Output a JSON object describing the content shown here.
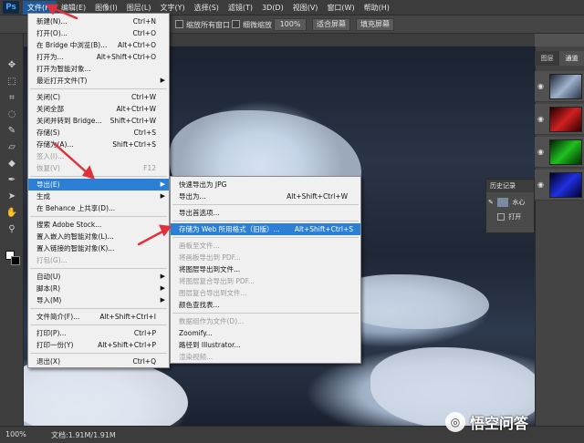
{
  "app": {
    "logo": "Ps"
  },
  "menubar": [
    "文件(F)",
    "编辑(E)",
    "图像(I)",
    "图层(L)",
    "文字(Y)",
    "选择(S)",
    "滤镜(T)",
    "3D(D)",
    "视图(V)",
    "窗口(W)",
    "帮助(H)"
  ],
  "options": {
    "fit_all_windows": "缩放所有窗口",
    "scrubby_zoom": "细微缩放",
    "zoom_value": "100%",
    "fit_screen": "适合屏幕",
    "fill_screen": "填充屏幕"
  },
  "file_menu": [
    {
      "label": "新建(N)...",
      "shortcut": "Ctrl+N"
    },
    {
      "label": "打开(O)...",
      "shortcut": "Ctrl+O"
    },
    {
      "label": "在 Bridge 中浏览(B)...",
      "shortcut": "Alt+Ctrl+O"
    },
    {
      "label": "打开为...",
      "shortcut": "Alt+Shift+Ctrl+O"
    },
    {
      "label": "打开为智能对象...",
      "shortcut": ""
    },
    {
      "label": "最近打开文件(T)",
      "shortcut": "",
      "submenu": true
    },
    {
      "label": "关闭(C)",
      "shortcut": "Ctrl+W"
    },
    {
      "label": "关闭全部",
      "shortcut": "Alt+Ctrl+W"
    },
    {
      "label": "关闭并转到 Bridge...",
      "shortcut": "Shift+Ctrl+W"
    },
    {
      "label": "存储(S)",
      "shortcut": "Ctrl+S"
    },
    {
      "label": "存储为(A)...",
      "shortcut": "Shift+Ctrl+S"
    },
    {
      "label": "签入(I)...",
      "shortcut": "",
      "disabled": true
    },
    {
      "label": "恢复(V)",
      "shortcut": "F12",
      "disabled": true
    },
    {
      "label": "导出(E)",
      "shortcut": "",
      "submenu": true,
      "highlight": true
    },
    {
      "label": "生成",
      "shortcut": "",
      "submenu": true
    },
    {
      "label": "在 Behance 上共享(D)...",
      "shortcut": ""
    },
    {
      "label": "搜索 Adobe Stock...",
      "shortcut": ""
    },
    {
      "label": "置入嵌入的智能对象(L)...",
      "shortcut": ""
    },
    {
      "label": "置入链接的智能对象(K)...",
      "shortcut": ""
    },
    {
      "label": "打包(G)...",
      "shortcut": "",
      "disabled": true
    },
    {
      "label": "自动(U)",
      "shortcut": "",
      "submenu": true
    },
    {
      "label": "脚本(R)",
      "shortcut": "",
      "submenu": true
    },
    {
      "label": "导入(M)",
      "shortcut": "",
      "submenu": true
    },
    {
      "label": "文件简介(F)...",
      "shortcut": "Alt+Shift+Ctrl+I"
    },
    {
      "label": "打印(P)...",
      "shortcut": "Ctrl+P"
    },
    {
      "label": "打印一份(Y)",
      "shortcut": "Alt+Shift+Ctrl+P"
    },
    {
      "label": "退出(X)",
      "shortcut": "Ctrl+Q"
    }
  ],
  "export_menu": [
    {
      "label": "快速导出为 JPG",
      "shortcut": ""
    },
    {
      "label": "导出为...",
      "shortcut": "Alt+Shift+Ctrl+W"
    },
    {
      "label": "导出首选项...",
      "shortcut": ""
    },
    {
      "label": "存储为 Web 所用格式（旧版）...",
      "shortcut": "Alt+Shift+Ctrl+S",
      "highlight": true
    },
    {
      "label": "画板至文件...",
      "shortcut": "",
      "disabled": true
    },
    {
      "label": "将画板导出到 PDF...",
      "shortcut": "",
      "disabled": true
    },
    {
      "label": "将图层导出到文件...",
      "shortcut": ""
    },
    {
      "label": "将图层复合导出到 PDF...",
      "shortcut": "",
      "disabled": true
    },
    {
      "label": "图层复合导出到文件...",
      "shortcut": "",
      "disabled": true
    },
    {
      "label": "颜色查找表...",
      "shortcut": ""
    },
    {
      "label": "数据组作为文件(D)...",
      "shortcut": "",
      "disabled": true
    },
    {
      "label": "Zoomify...",
      "shortcut": ""
    },
    {
      "label": "路径到 Illustrator...",
      "shortcut": ""
    },
    {
      "label": "渲染视频...",
      "shortcut": "",
      "disabled": true
    }
  ],
  "panels": {
    "tab_layers": "图层",
    "tab_channels": "通道",
    "history_title": "历史记录",
    "history_snapshot": "水心",
    "history_open": "打开"
  },
  "status": {
    "zoom": "100%",
    "doc": "文档:1.91M/1.91M"
  },
  "watermark": {
    "text": "悟空问答"
  },
  "colors": {
    "highlight": "#2b7fd4",
    "arrow": "#e0303a"
  }
}
